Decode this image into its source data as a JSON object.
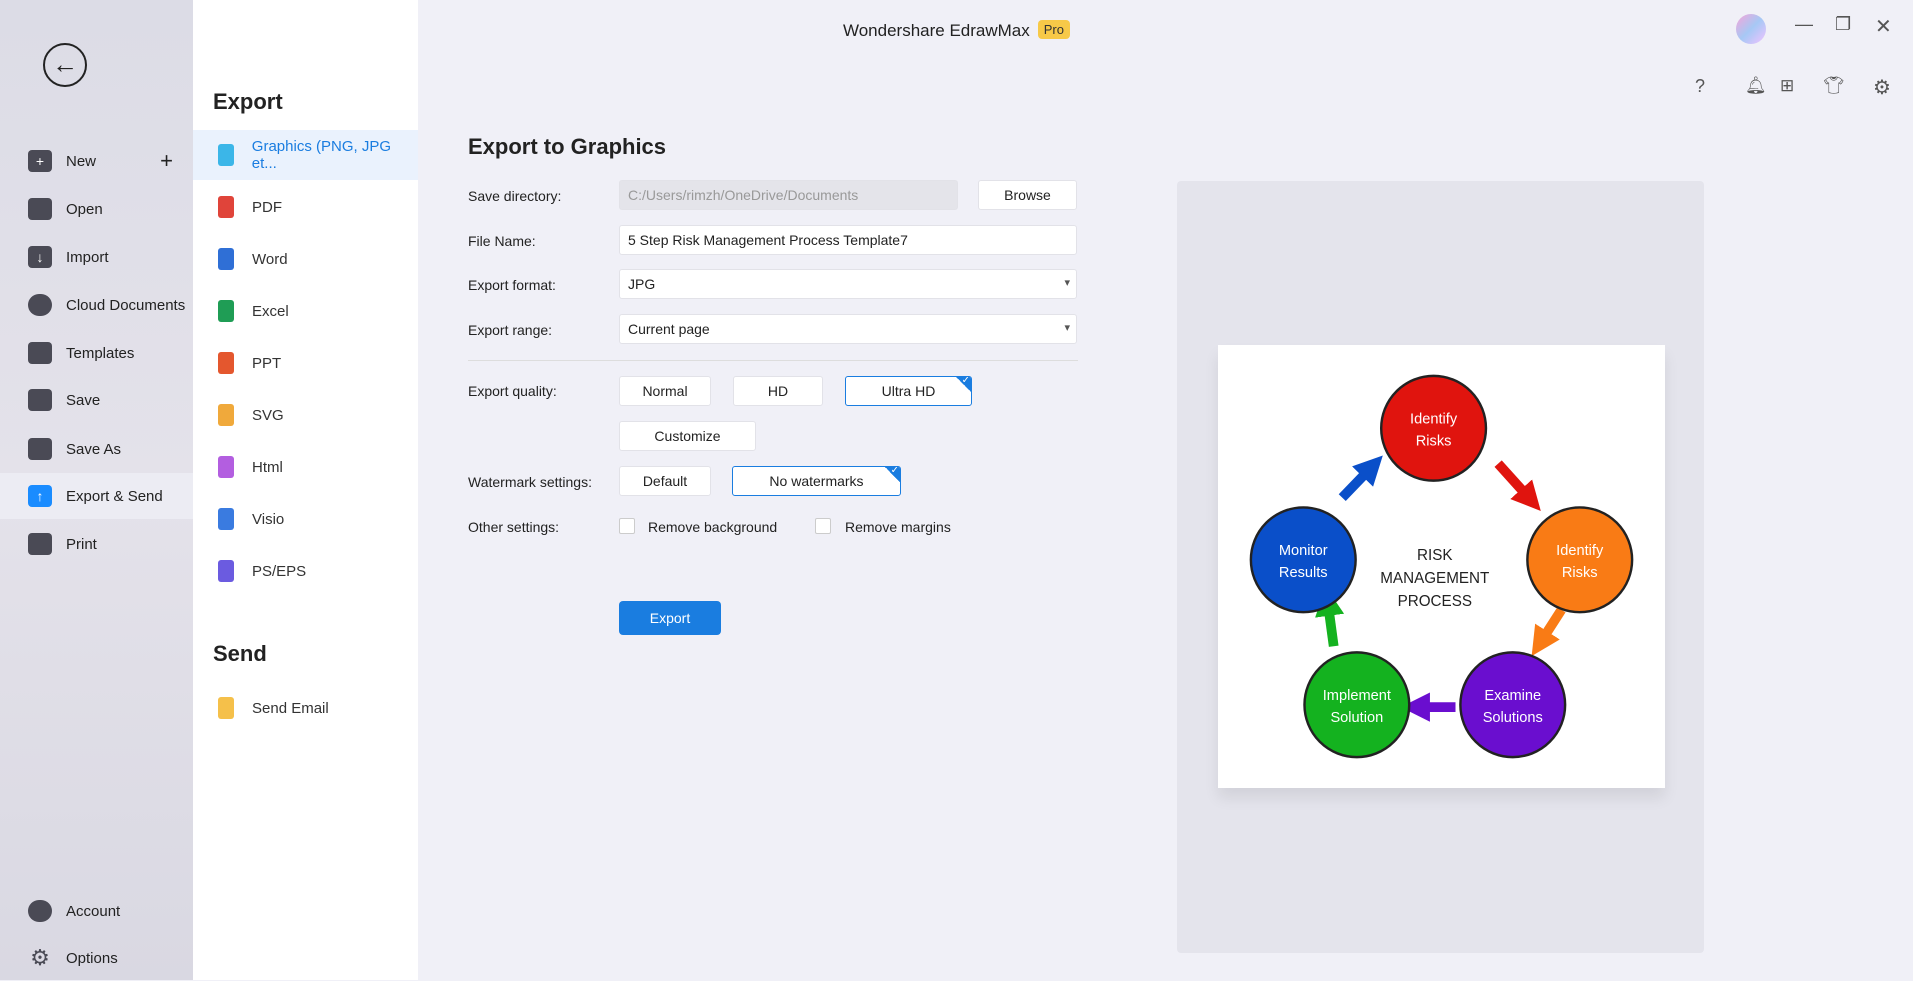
{
  "app": {
    "title": "Wondershare EdrawMax",
    "badge": "Pro"
  },
  "sidebar": {
    "items": [
      {
        "label": "New",
        "icon": "plus-square-icon"
      },
      {
        "label": "Open",
        "icon": "folder-icon"
      },
      {
        "label": "Import",
        "icon": "import-icon"
      },
      {
        "label": "Cloud Documents",
        "icon": "cloud-icon"
      },
      {
        "label": "Templates",
        "icon": "templates-icon"
      },
      {
        "label": "Save",
        "icon": "save-icon"
      },
      {
        "label": "Save As",
        "icon": "save-as-icon"
      },
      {
        "label": "Export & Send",
        "icon": "export-icon",
        "active": true
      },
      {
        "label": "Print",
        "icon": "print-icon"
      }
    ],
    "bottom": [
      {
        "label": "Account",
        "icon": "account-icon"
      },
      {
        "label": "Options",
        "icon": "gear-icon"
      }
    ]
  },
  "export_panel": {
    "heading": "Export",
    "items": [
      {
        "label": "Graphics (PNG, JPG et...",
        "color": "#3bb6e8"
      },
      {
        "label": "PDF",
        "color": "#e0443a"
      },
      {
        "label": "Word",
        "color": "#2f6fd6"
      },
      {
        "label": "Excel",
        "color": "#1f9d55"
      },
      {
        "label": "PPT",
        "color": "#e4572e"
      },
      {
        "label": "SVG",
        "color": "#f0a93b"
      },
      {
        "label": "Html",
        "color": "#b35ee0"
      },
      {
        "label": "Visio",
        "color": "#3a7be0"
      },
      {
        "label": "PS/EPS",
        "color": "#6b5be0"
      }
    ],
    "send_heading": "Send",
    "send_items": [
      {
        "label": "Send Email",
        "color": "#f5c04a"
      }
    ]
  },
  "form": {
    "heading": "Export to Graphics",
    "save_directory": {
      "label": "Save directory:",
      "value": "C:/Users/rimzh/OneDrive/Documents",
      "browse": "Browse"
    },
    "file_name": {
      "label": "File Name:",
      "value": "5 Step Risk Management Process Template7"
    },
    "format": {
      "label": "Export format:",
      "value": "JPG"
    },
    "range": {
      "label": "Export range:",
      "value": "Current page"
    },
    "quality": {
      "label": "Export quality:",
      "options": [
        "Normal",
        "HD",
        "Ultra HD"
      ],
      "selected": "Ultra HD",
      "customize": "Customize"
    },
    "watermark": {
      "label": "Watermark settings:",
      "options": [
        "Default",
        "No watermarks"
      ],
      "selected": "No watermarks"
    },
    "other": {
      "label": "Other settings:",
      "remove_background": "Remove background",
      "remove_margins": "Remove margins"
    },
    "export_button": "Export"
  },
  "preview": {
    "center": [
      "RISK",
      "MANAGEMENT",
      "PROCESS"
    ],
    "nodes": [
      {
        "l1": "Identify",
        "l2": "Risks",
        "color": "#e0140e"
      },
      {
        "l1": "Identify",
        "l2": "Risks",
        "color": "#f97b15"
      },
      {
        "l1": "Examine",
        "l2": "Solutions",
        "color": "#6a0ecf"
      },
      {
        "l1": "Implement",
        "l2": "Solution",
        "color": "#14b21f"
      },
      {
        "l1": "Monitor",
        "l2": "Results",
        "color": "#0a4fc9"
      }
    ]
  }
}
